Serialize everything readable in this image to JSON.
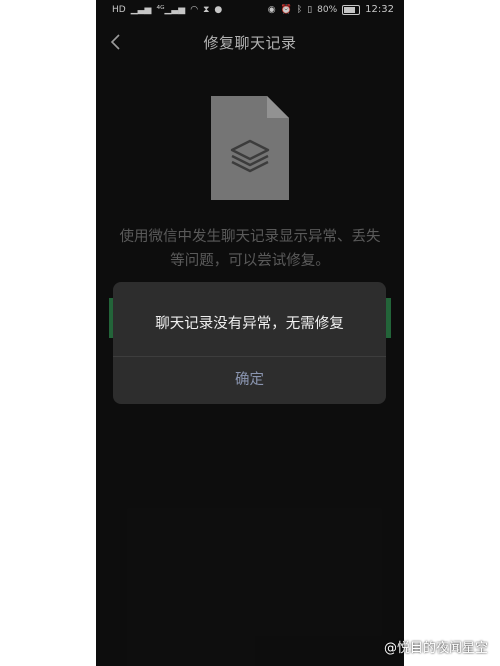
{
  "status_bar": {
    "left_icons": [
      "HD",
      "ıll",
      "⁴⁶ıll",
      "wifi",
      "hourglass",
      "wechat"
    ],
    "battery": "80%",
    "time": "12:32",
    "battery_level": 0.8
  },
  "header": {
    "title": "修复聊天记录"
  },
  "main": {
    "description": "使用微信中发生聊天记录显示异常、丢失等问题，可以尝试修复。"
  },
  "dialog": {
    "message": "聊天记录没有异常，无需修复",
    "confirm_label": "确定"
  },
  "watermark": {
    "text": "@悦目的夜闻星空"
  },
  "colors": {
    "background": "#111111",
    "accent_green": "#2b7a46",
    "dialog_bg": "#2d2d2d"
  }
}
